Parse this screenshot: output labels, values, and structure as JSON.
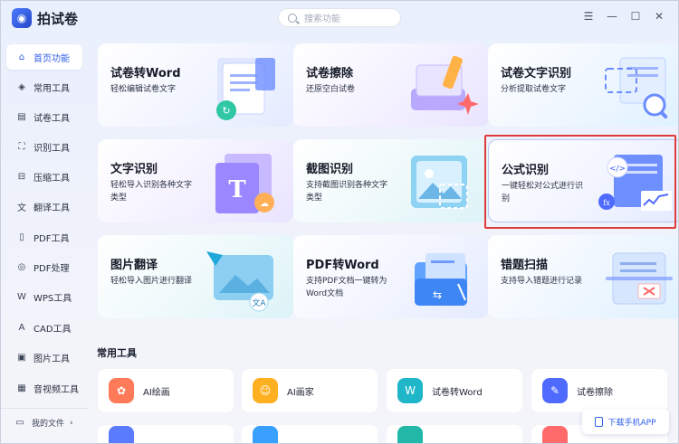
{
  "app": {
    "title": "拍试卷"
  },
  "search": {
    "placeholder": "搜索功能"
  },
  "window_controls": {
    "menu": "☰",
    "minimize": "—",
    "maximize": "☐",
    "close": "✕"
  },
  "sidebar": {
    "items": [
      {
        "label": "首页功能",
        "icon": "home-icon",
        "glyph": "⌂",
        "active": true
      },
      {
        "label": "常用工具",
        "icon": "layers-icon",
        "glyph": "◈"
      },
      {
        "label": "试卷工具",
        "icon": "paper-icon",
        "glyph": "▤"
      },
      {
        "label": "识别工具",
        "icon": "scan-icon",
        "glyph": "⛶"
      },
      {
        "label": "压缩工具",
        "icon": "compress-icon",
        "glyph": "⊟"
      },
      {
        "label": "翻译工具",
        "icon": "translate-icon",
        "glyph": "文"
      },
      {
        "label": "PDF工具",
        "icon": "pdf-icon",
        "glyph": "▯"
      },
      {
        "label": "PDF处理",
        "icon": "pdf-process-icon",
        "glyph": "◎"
      },
      {
        "label": "WPS工具",
        "icon": "wps-icon",
        "glyph": "W"
      },
      {
        "label": "CAD工具",
        "icon": "cad-icon",
        "glyph": "A"
      },
      {
        "label": "图片工具",
        "icon": "image-icon",
        "glyph": "▣"
      },
      {
        "label": "音视频工具",
        "icon": "media-icon",
        "glyph": "▦"
      }
    ],
    "my_files": "我的文件",
    "my_files_arrow": "›"
  },
  "cards": [
    {
      "title": "试卷转Word",
      "desc": "轻松编辑试卷文字",
      "icon": "word-doc-icon"
    },
    {
      "title": "试卷擦除",
      "desc": "还原空白试卷",
      "icon": "eraser-icon"
    },
    {
      "title": "试卷文字识别",
      "desc": "分析提取试卷文字",
      "icon": "text-scan-icon"
    },
    {
      "title": "文字识别",
      "desc": "轻松导入识别各种文字类型",
      "icon": "text-recognition-icon"
    },
    {
      "title": "截图识别",
      "desc": "支持截图识别各种文字类型",
      "icon": "screenshot-icon"
    },
    {
      "title": "公式识别",
      "desc": "一键轻松对公式进行识别",
      "icon": "formula-icon"
    },
    {
      "title": "图片翻译",
      "desc": "轻松导入图片进行翻译",
      "icon": "image-translate-icon"
    },
    {
      "title": "PDF转Word",
      "desc": "支持PDF文档一键转为Word文档",
      "icon": "pdf-to-word-icon"
    },
    {
      "title": "错题扫描",
      "desc": "支持导入错题进行记录",
      "icon": "mistake-scan-icon"
    }
  ],
  "common_tools": {
    "title": "常用工具",
    "items": [
      {
        "label": "AI绘画",
        "icon": "ai-paint-icon",
        "color": "#ff7a59",
        "glyph": "✿"
      },
      {
        "label": "AI画家",
        "icon": "ai-artist-icon",
        "color": "#ffb020",
        "glyph": "☺"
      },
      {
        "label": "试卷转Word",
        "icon": "paper-word-icon",
        "color": "#1fb6c9",
        "glyph": "W"
      },
      {
        "label": "试卷擦除",
        "icon": "paper-erase-icon",
        "color": "#4f6bff",
        "glyph": "✎"
      }
    ]
  },
  "download_app": "下载手机APP",
  "colors": {
    "accent": "#2f5ee8",
    "highlight": "#e03b3b"
  }
}
